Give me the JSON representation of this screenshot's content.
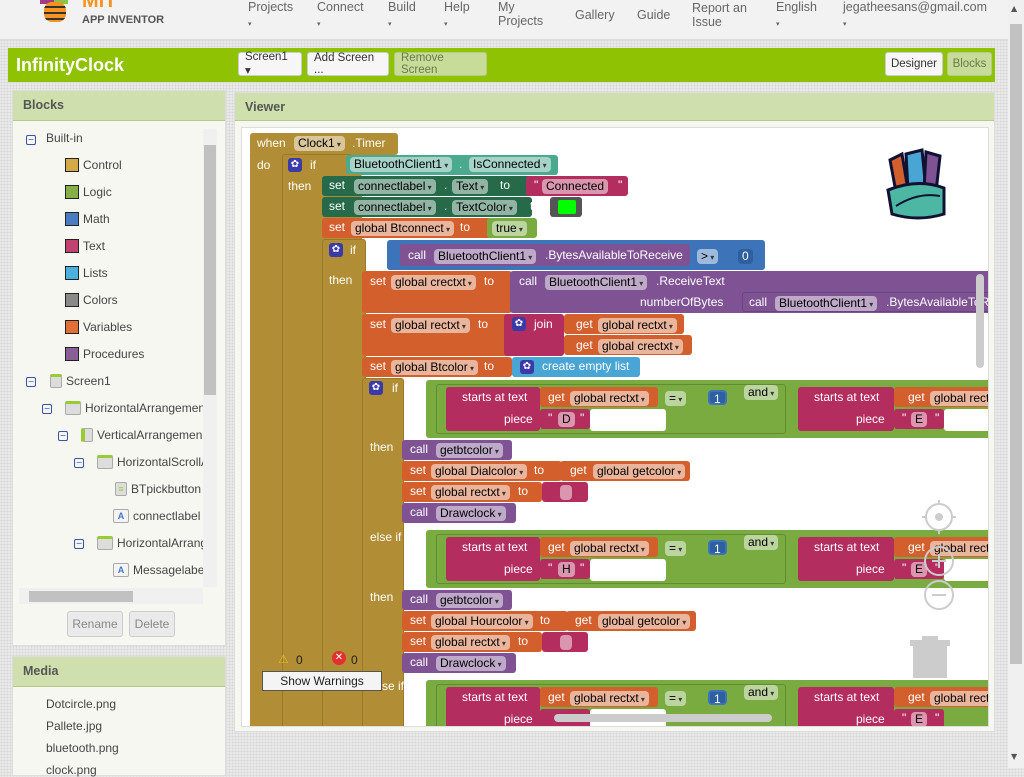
{
  "topbar": {
    "logo_title": "MIT",
    "logo_subtitle": "APP INVENTOR",
    "nav": [
      {
        "label": "Projects",
        "dropdown": true
      },
      {
        "label": "Connect",
        "dropdown": true
      },
      {
        "label": "Build",
        "dropdown": true
      },
      {
        "label": "Help",
        "dropdown": true
      },
      {
        "label": "My Projects",
        "dropdown": false
      },
      {
        "label": "Gallery",
        "dropdown": false
      },
      {
        "label": "Guide",
        "dropdown": false
      },
      {
        "label": "Report an Issue",
        "dropdown": false
      },
      {
        "label": "English",
        "dropdown": true
      },
      {
        "label": "jegatheesans@gmail.com",
        "dropdown": true
      }
    ]
  },
  "project": {
    "title": "InfinityClock",
    "screen_select": "Screen1 ▾",
    "add_screen": "Add Screen ...",
    "remove_screen": "Remove Screen",
    "designer": "Designer",
    "blocks": "Blocks"
  },
  "blocks_panel": {
    "title": "Blocks",
    "builtin_label": "Built-in",
    "builtin": [
      {
        "label": "Control",
        "color": "#d4aa48"
      },
      {
        "label": "Logic",
        "color": "#84b04c"
      },
      {
        "label": "Math",
        "color": "#4a7ac0"
      },
      {
        "label": "Text",
        "color": "#c0426f"
      },
      {
        "label": "Lists",
        "color": "#4ab0dc"
      },
      {
        "label": "Colors",
        "color": "#8a8a8a"
      },
      {
        "label": "Variables",
        "color": "#e07038"
      },
      {
        "label": "Procedures",
        "color": "#8a5f98"
      }
    ],
    "components": [
      {
        "label": "Screen1",
        "icon": "screen-icon",
        "level": 0
      },
      {
        "label": "HorizontalArrangemen",
        "icon": "horizontal-arrangement-icon",
        "level": 1
      },
      {
        "label": "VerticalArrangemen",
        "icon": "vertical-arrangement-icon",
        "level": 2
      },
      {
        "label": "HorizontalScrollA",
        "icon": "horizontal-arrangement-icon",
        "level": 3
      },
      {
        "label": "BTpickbutton",
        "icon": "listpicker-icon",
        "level": 4
      },
      {
        "label": "connectlabel",
        "icon": "label-icon",
        "level": 4
      },
      {
        "label": "HorizontalArrang",
        "icon": "horizontal-arrangement-icon",
        "level": 3
      },
      {
        "label": "Messagelabe",
        "icon": "label-icon",
        "level": 4
      }
    ],
    "rename": "Rename",
    "delete": "Delete"
  },
  "media_panel": {
    "title": "Media",
    "items": [
      "Dotcircle.png",
      "Pallete.jpg",
      "bluetooth.png",
      "clock.png"
    ]
  },
  "viewer": {
    "title": "Viewer",
    "warnings_count": "0",
    "errors_count": "0",
    "show_warnings": "Show Warnings",
    "code": {
      "event_when": "when",
      "event_component": "Clock1",
      "event_name": ".Timer",
      "do": "do",
      "if": "if",
      "then": "then",
      "else_if": "else if",
      "bt_component": "BluetoothClient1",
      "dot": ".",
      "is_connected": "IsConnected",
      "set": "set",
      "to": "to",
      "call": "call",
      "get": "get",
      "connectlabel": "connectlabel",
      "text_prop": "Text",
      "textcolor_prop": "TextColor",
      "connected_str": "Connected",
      "quote": "\"",
      "green_color": "#00ff00",
      "global_btconnect": "global Btconnect",
      "true": "true",
      "bytes_available": ".BytesAvailableToReceive",
      "gt_op": ">",
      "zero": "0",
      "global_crectxt": "global crectxt",
      "receive_text": ".ReceiveText",
      "number_of_bytes": "numberOfBytes",
      "bytes_available_trunc": ".BytesAvailableToR",
      "global_rectxt": "global rectxt",
      "join": "join",
      "global_btcolor": "global Btcolor",
      "create_empty_list": "create empty list",
      "starts_at_text": "starts at  text",
      "piece": "piece",
      "eq_op": "=",
      "one": "1",
      "and": "and",
      "global_rect_trunc": "global rect",
      "piece_d": "D",
      "piece_e": "E",
      "piece_h": "H",
      "getbtcolor": "getbtcolor",
      "global_dialcolor": "global Dialcolor",
      "global_hourcolor": "global Hourcolor",
      "global_getcolor": "global getcolor",
      "drawclock": "Drawclock",
      "else_if_trunc": "se if"
    }
  }
}
